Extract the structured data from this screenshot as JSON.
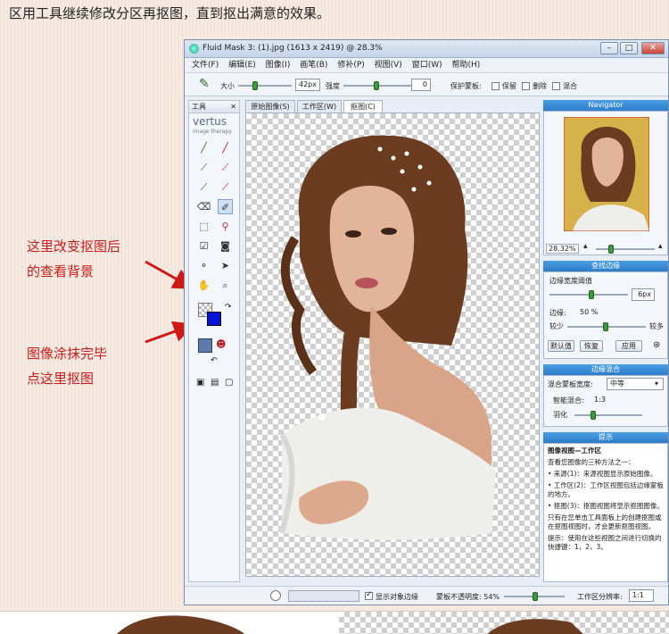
{
  "caption": "区用工具继续修改分区再抠图，直到抠出满意的效果。",
  "annotations": {
    "background": [
      "这里改变抠图后",
      "的查看背景"
    ],
    "cutout": [
      "图像涂抹完毕",
      "点这里抠图"
    ]
  },
  "window": {
    "title": "Fluid Mask 3: (1).jpg (1613 x 2419) @ 28.3%",
    "buttons": [
      "–",
      "□",
      "✕"
    ]
  },
  "menu": [
    "文件(F)",
    "编辑(E)",
    "图像(I)",
    "画笔(B)",
    "修补(P)",
    "视图(V)",
    "窗口(W)",
    "帮助(H)"
  ],
  "toolbar": {
    "size_label": "大小",
    "size_value": "42px",
    "hardness_label": "强度",
    "hardness_value": "0",
    "protect_label": "保护蒙板:",
    "protect_options": [
      "保留",
      "删除",
      "混合"
    ]
  },
  "tools_panel": {
    "title": "工具",
    "logo": "vertus",
    "logo_sub": "image therapy"
  },
  "tabs": [
    {
      "label": "原始图像(S)",
      "active": false
    },
    {
      "label": "工作区(W)",
      "active": false
    },
    {
      "label": "抠图(C)",
      "active": true
    }
  ],
  "navigator": {
    "title": "Navigator",
    "zoom": "28.32%"
  },
  "edge_panel": {
    "title": "查找边缘",
    "threshold_label": "边缘宽度阈值",
    "width_value": "6px",
    "contrast_label": "边缘:",
    "contrast_value": "50 %",
    "low_label": "较少",
    "high_label": "较多",
    "buttons": [
      "默认值",
      "恢复",
      "应用"
    ]
  },
  "blend_panel": {
    "title": "边缘混合",
    "mode_label": "混合蒙板宽度:",
    "mode_value": "中等",
    "ratio_label": "智能混合:",
    "ratio_value": "1:3",
    "feather_label": "羽化"
  },
  "hint_panel": {
    "title": "提示",
    "heading": "图像视图—工作区",
    "intro": "查看您图像的三种方法之一：",
    "items": [
      "• 来源(1)：来源视图显示原始图像。",
      "• 工作区(2)：工作区视图包括边缘蒙板的地方。",
      "• 抠图(3)：抠图视图将显示抠图图像。"
    ],
    "note": "只有在您单击工具面板上的创建抠图或在抠图视图时，才会更新抠图视图。",
    "tip": "提示：使用在这些视图之间进行切换的快捷键：1，2，3。"
  },
  "statusbar": {
    "show_edges_label": "显示对象边缘",
    "opacity_label": "蒙板不透明度: 54%",
    "work_res_label": "工作区分辨率:",
    "work_res_value": "1:1"
  },
  "colors": {
    "accent": "#2d7cc8",
    "annotation": "#cc1a1a",
    "swatch_fg": "#0014d8"
  }
}
